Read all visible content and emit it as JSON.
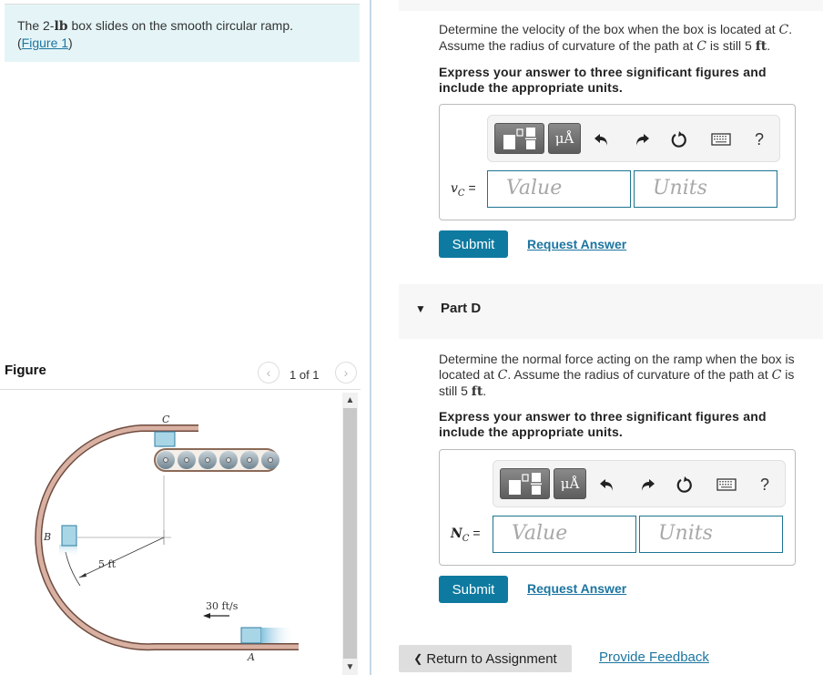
{
  "intro": {
    "text_prefix": "The 2-",
    "unit_lb": "lb",
    "text_suffix": " box slides on the smooth circular ramp.",
    "figure_link_open": "(",
    "figure_link": "Figure 1",
    "figure_link_close": ")"
  },
  "figure_panel": {
    "title": "Figure",
    "pager_text": "1 of 1",
    "prev_icon": "‹",
    "next_icon": "›",
    "labels": {
      "C": "C",
      "B": "B",
      "A": "A",
      "radius": "5 ft",
      "speed": "30 ft/s"
    }
  },
  "scrollbar": {
    "up_icon": "▲",
    "down_icon": "▼"
  },
  "part_c": {
    "question_line1_prefix": "Determine the velocity of the box when the box is located at ",
    "point": "C",
    "question_line2_prefix": "Assume the radius of curvature of the path at ",
    "question_line2_suffix": " is still 5 ",
    "unit_ft": "ft",
    "period": ".",
    "instruction": "Express your answer to three significant figures and include the appropriate units.",
    "variable": "v",
    "variable_sub": "C",
    "equals": " =",
    "value_placeholder": "Value",
    "units_placeholder": "Units",
    "submit_label": "Submit",
    "request_answer_label": "Request Answer"
  },
  "toolbar": {
    "units_label": "μÅ",
    "help_label": "?"
  },
  "part_d": {
    "caret": "▼",
    "title": "Part D",
    "question_prefix": "Determine the normal force acting on the ramp when the box is located at ",
    "point": "C",
    "question_mid": ". Assume the radius of curvature of the path at ",
    "question_suffix": " is still 5 ",
    "unit_ft": "ft",
    "period": ".",
    "instruction": "Express your answer to three significant figures and include the appropriate units.",
    "variable": "N",
    "variable_sub": "C",
    "equals": " =",
    "value_placeholder": "Value",
    "units_placeholder": "Units",
    "submit_label": "Submit",
    "request_answer_label": "Request Answer"
  },
  "footer": {
    "return_label": "Return to Assignment",
    "return_icon": "❮",
    "feedback_label": "Provide Feedback"
  }
}
